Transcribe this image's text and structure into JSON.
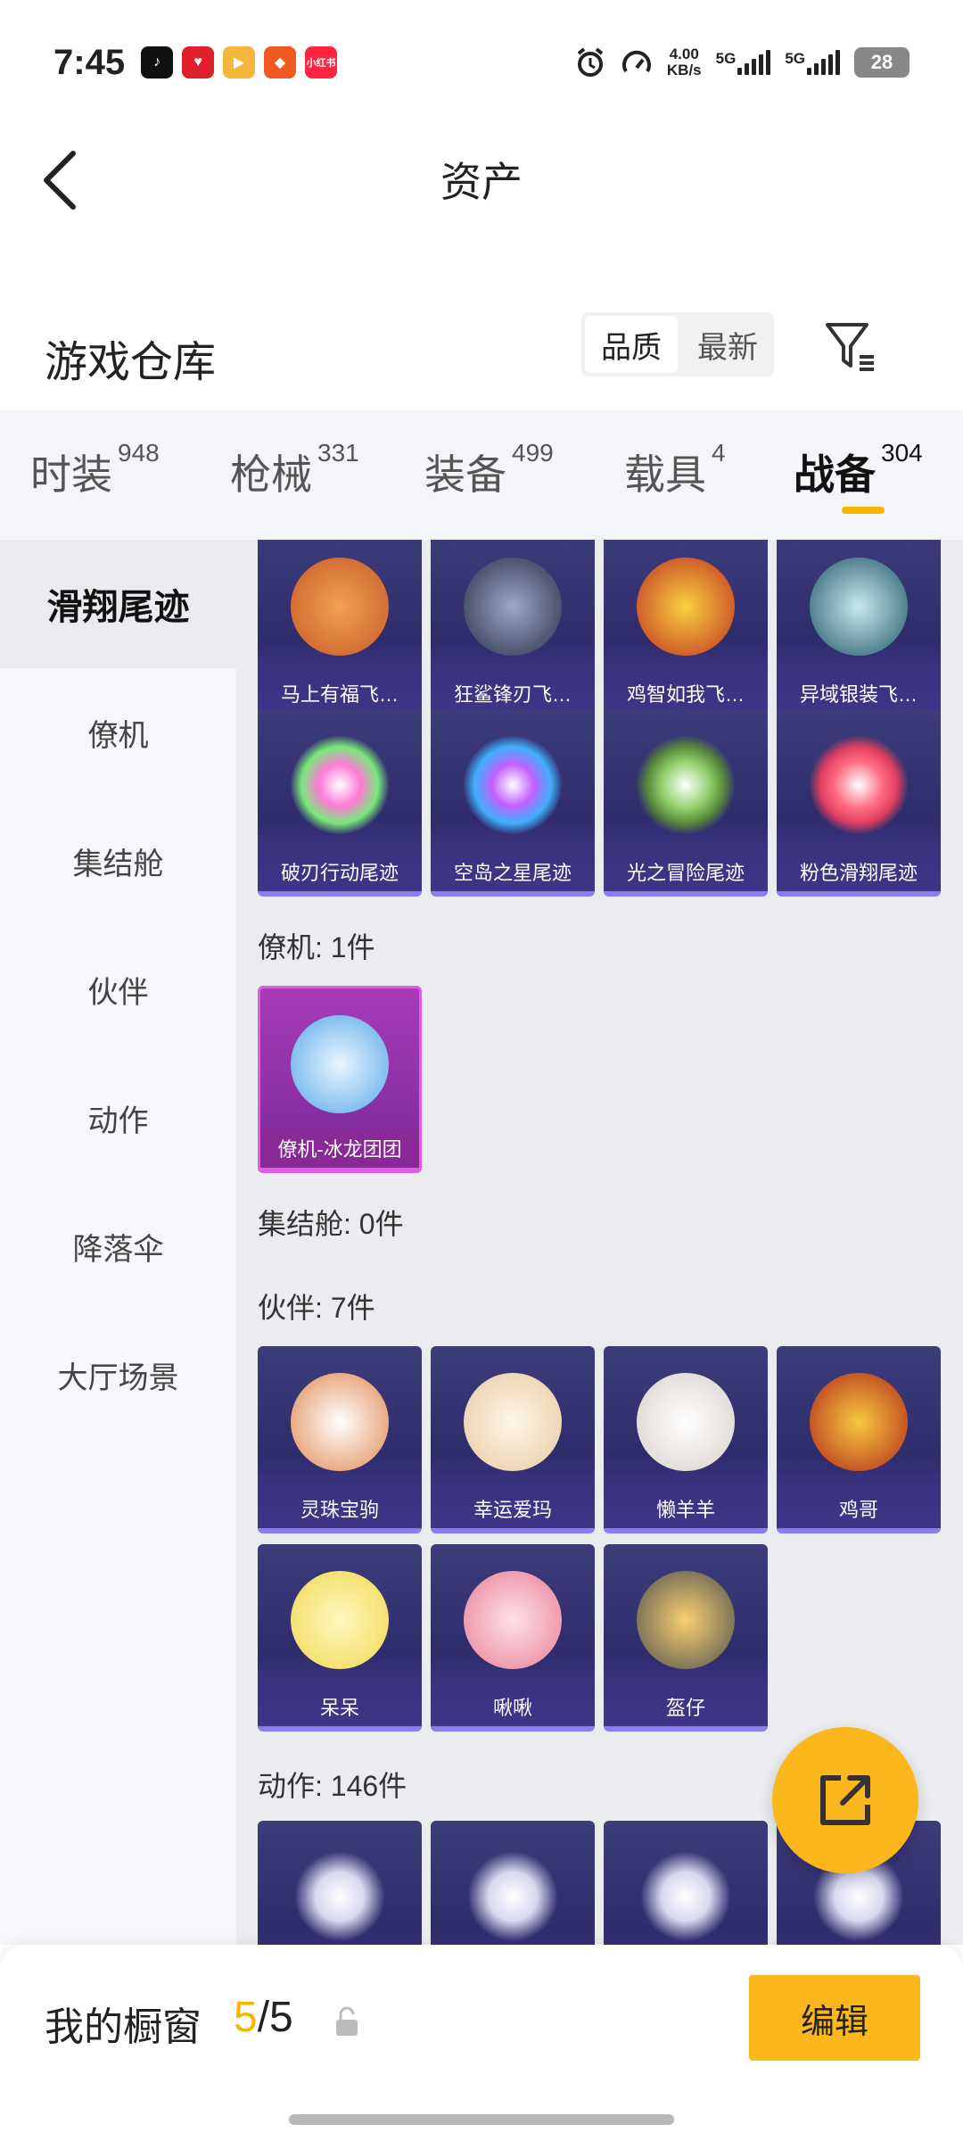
{
  "status_bar": {
    "time": "7:45",
    "net_speed": "4.00\nKB/s",
    "net_speed_value": "4.00",
    "net_speed_unit": "KB/s",
    "network1": "5G",
    "network2": "5G",
    "battery": "28",
    "app_icons": [
      "tiktok-icon",
      "pinduoduo-icon",
      "video-app-icon",
      "game-app-icon",
      "xiaohongshu-icon"
    ],
    "app_icon_texts": [
      "",
      "",
      "",
      "",
      "小红书"
    ]
  },
  "header": {
    "title": "资产"
  },
  "warehouse": {
    "title": "游戏仓库",
    "sort_options": [
      "品质",
      "最新"
    ]
  },
  "tabs": [
    {
      "label": "时装",
      "count": "948"
    },
    {
      "label": "枪械",
      "count": "331"
    },
    {
      "label": "装备",
      "count": "499"
    },
    {
      "label": "载具",
      "count": "4"
    },
    {
      "label": "战备",
      "count": "304"
    }
  ],
  "sidebar": {
    "items": [
      "滑翔尾迹",
      "僚机",
      "集结舱",
      "伙伴",
      "动作",
      "降落伞",
      "大厅场景"
    ]
  },
  "sections": {
    "glide_trail_items": [
      "马上有福飞…",
      "狂鲨锋刃飞…",
      "鸡智如我飞…",
      "异域银装飞…",
      "破刃行动尾迹",
      "空岛之星尾迹",
      "光之冒险尾迹",
      "粉色滑翔尾迹"
    ],
    "wingman_title": "僚机: 1件",
    "wingman_items": [
      "僚机-冰龙团团"
    ],
    "pod_title": "集结舱: 0件",
    "partner_title": "伙伴: 7件",
    "partner_items": [
      "灵珠宝驹",
      "幸运爱玛",
      "懒羊羊",
      "鸡哥",
      "呆呆",
      "啾啾",
      "盔仔"
    ],
    "action_title": "动作: 146件"
  },
  "bottom_bar": {
    "label": "我的橱窗",
    "count_current": "5",
    "count_total": "/5",
    "edit_label": "编辑"
  },
  "colors": {
    "accent": "#f7b500",
    "button": "#fbb71b",
    "card": "#2f2c6c",
    "card_highlight": "#e05de8"
  }
}
